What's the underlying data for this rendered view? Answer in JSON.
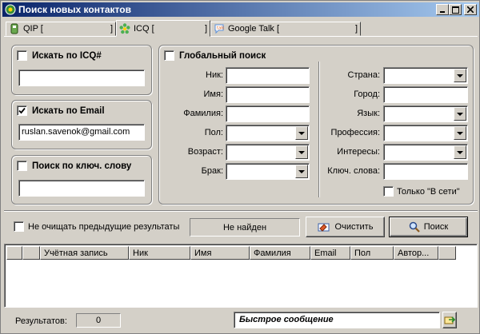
{
  "window": {
    "title": "Поиск новых контактов"
  },
  "tabs": [
    {
      "label": "QIP [",
      "bracket": "]",
      "icon": "qip-icon"
    },
    {
      "label": "ICQ [",
      "bracket": "]",
      "icon": "icq-flower-icon"
    },
    {
      "label": "Google Talk [",
      "bracket": "]",
      "icon": "gtalk-icon"
    }
  ],
  "search_icq": {
    "label": "Искать по ICQ#",
    "checked": false,
    "value": ""
  },
  "search_email": {
    "label": "Искать по Email",
    "checked": true,
    "value": "ruslan.savenok@gmail.com"
  },
  "search_keyword": {
    "label": "Поиск по ключ. слову",
    "checked": false,
    "value": ""
  },
  "global": {
    "label": "Глобальный поиск",
    "nick": "Ник:",
    "name": "Имя:",
    "surname": "Фамилия:",
    "gender": "Пол:",
    "age": "Возраст:",
    "marital": "Брак:",
    "country": "Страна:",
    "city": "Город:",
    "language": "Язык:",
    "profession": "Профессия:",
    "interests": "Интересы:",
    "keywords": "Ключ. слова:",
    "online_only": "Только \"В сети\""
  },
  "actions": {
    "keep_results": "Не очищать предыдущие результаты",
    "status": "Не найден",
    "clear": "Очистить",
    "search": "Поиск"
  },
  "columns": [
    "",
    "",
    "Учётная запись",
    "Ник",
    "Имя",
    "Фамилия",
    "Email",
    "Пол",
    "Автор...",
    ""
  ],
  "status": {
    "results_label": "Результатов:",
    "results_count": "0",
    "quick_message": "Быстрое сообщение"
  }
}
